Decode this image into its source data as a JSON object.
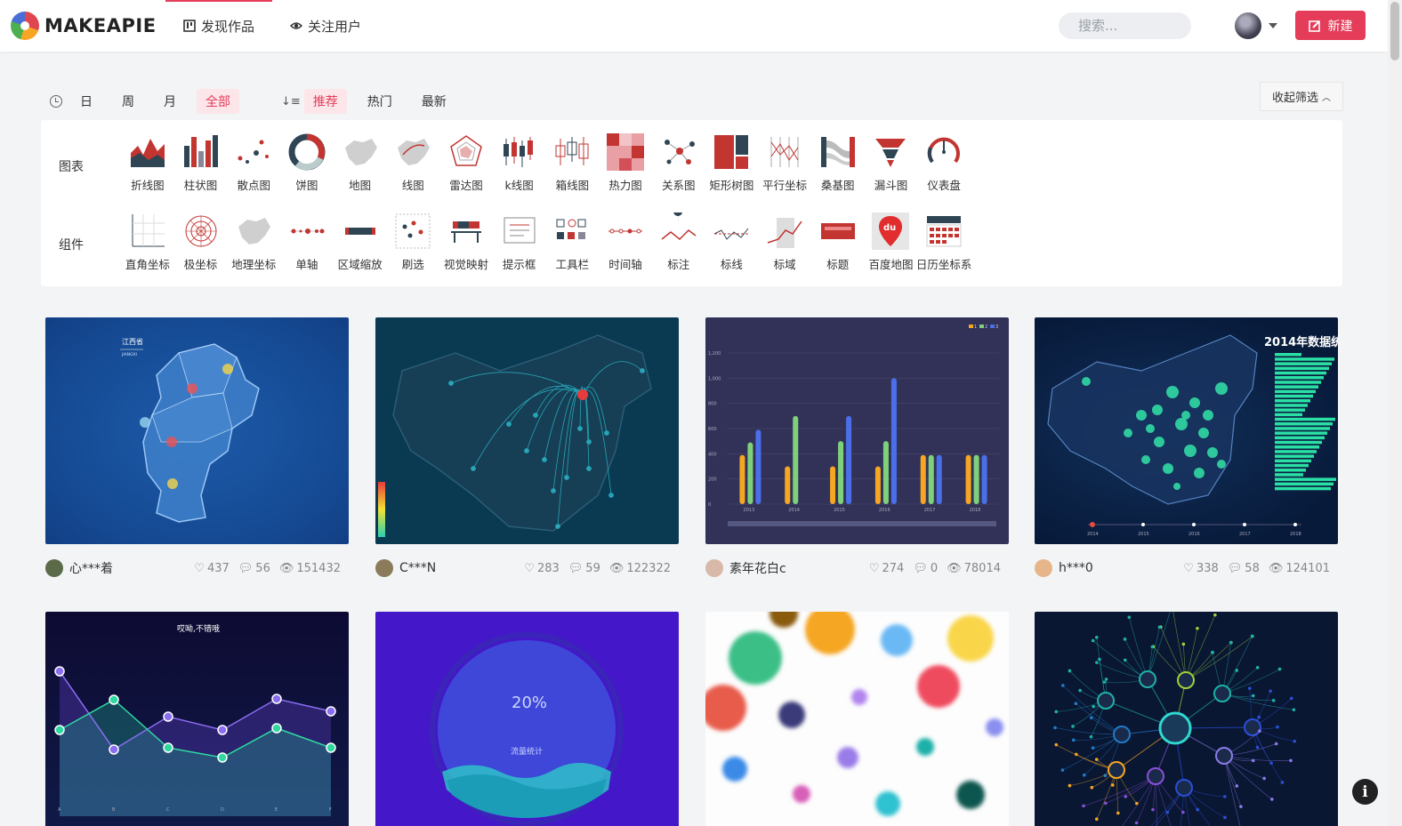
{
  "header": {
    "logo_text": "MAKEAPIE",
    "nav": [
      {
        "label": "发现作品",
        "icon": "chart-icon",
        "active": true
      },
      {
        "label": "关注用户",
        "icon": "eye-icon",
        "active": false
      }
    ],
    "search_placeholder": "搜索...",
    "new_button": "新建",
    "accent": "#e43c59"
  },
  "filters": {
    "time": [
      "日",
      "周",
      "月",
      "全部"
    ],
    "time_active": "全部",
    "sort": [
      "推荐",
      "热门",
      "最新"
    ],
    "sort_active": "推荐",
    "collapse_label": "收起筛选"
  },
  "categories": {
    "charts_label": "图表",
    "charts": [
      "折线图",
      "柱状图",
      "散点图",
      "饼图",
      "地图",
      "线图",
      "雷达图",
      "k线图",
      "箱线图",
      "热力图",
      "关系图",
      "矩形树图",
      "平行坐标",
      "桑基图",
      "漏斗图",
      "仪表盘"
    ],
    "components_label": "组件",
    "components": [
      "直角坐标",
      "极坐标",
      "地理坐标",
      "单轴",
      "区域缩放",
      "刷选",
      "视觉映射",
      "提示框",
      "工具栏",
      "时间轴",
      "标注",
      "标线",
      "标域",
      "标题",
      "百度地图",
      "日历坐标系"
    ],
    "component_baidu_mark": "du"
  },
  "cards": [
    {
      "user": "心***着",
      "likes": "437",
      "comments": "56",
      "views": "151432",
      "thumb": "jiangxi-map",
      "thumb_title": "江西省",
      "thumb_subtitle": "JIANGXI"
    },
    {
      "user": "C***N",
      "likes": "283",
      "comments": "59",
      "views": "122322",
      "thumb": "china-flight-map"
    },
    {
      "user": "素年花白c",
      "likes": "274",
      "comments": "0",
      "views": "78014",
      "thumb": "bar-chart",
      "legend": [
        "1",
        "2",
        "3"
      ],
      "x_ticks": [
        "2013",
        "2014",
        "2015",
        "2016",
        "2017",
        "2018"
      ],
      "y_ticks": [
        "0",
        "200",
        "400",
        "600",
        "800",
        "1,000",
        "1,200"
      ]
    },
    {
      "user": "h***0",
      "likes": "338",
      "comments": "58",
      "views": "124101",
      "thumb": "china-scatter-map",
      "thumb_title": "2014年数据统",
      "timeline": [
        "2014",
        "2015",
        "2016",
        "2017",
        "2018"
      ]
    },
    {
      "thumb": "line-chart",
      "thumb_title": "哎呦,不错哦",
      "x_ticks": [
        "A",
        "B",
        "C",
        "D",
        "E",
        "F"
      ]
    },
    {
      "thumb": "liquid-gauge",
      "percent": "20%",
      "label": "流量统计"
    },
    {
      "thumb": "bubble-cloud"
    },
    {
      "thumb": "radial-tree"
    }
  ]
}
